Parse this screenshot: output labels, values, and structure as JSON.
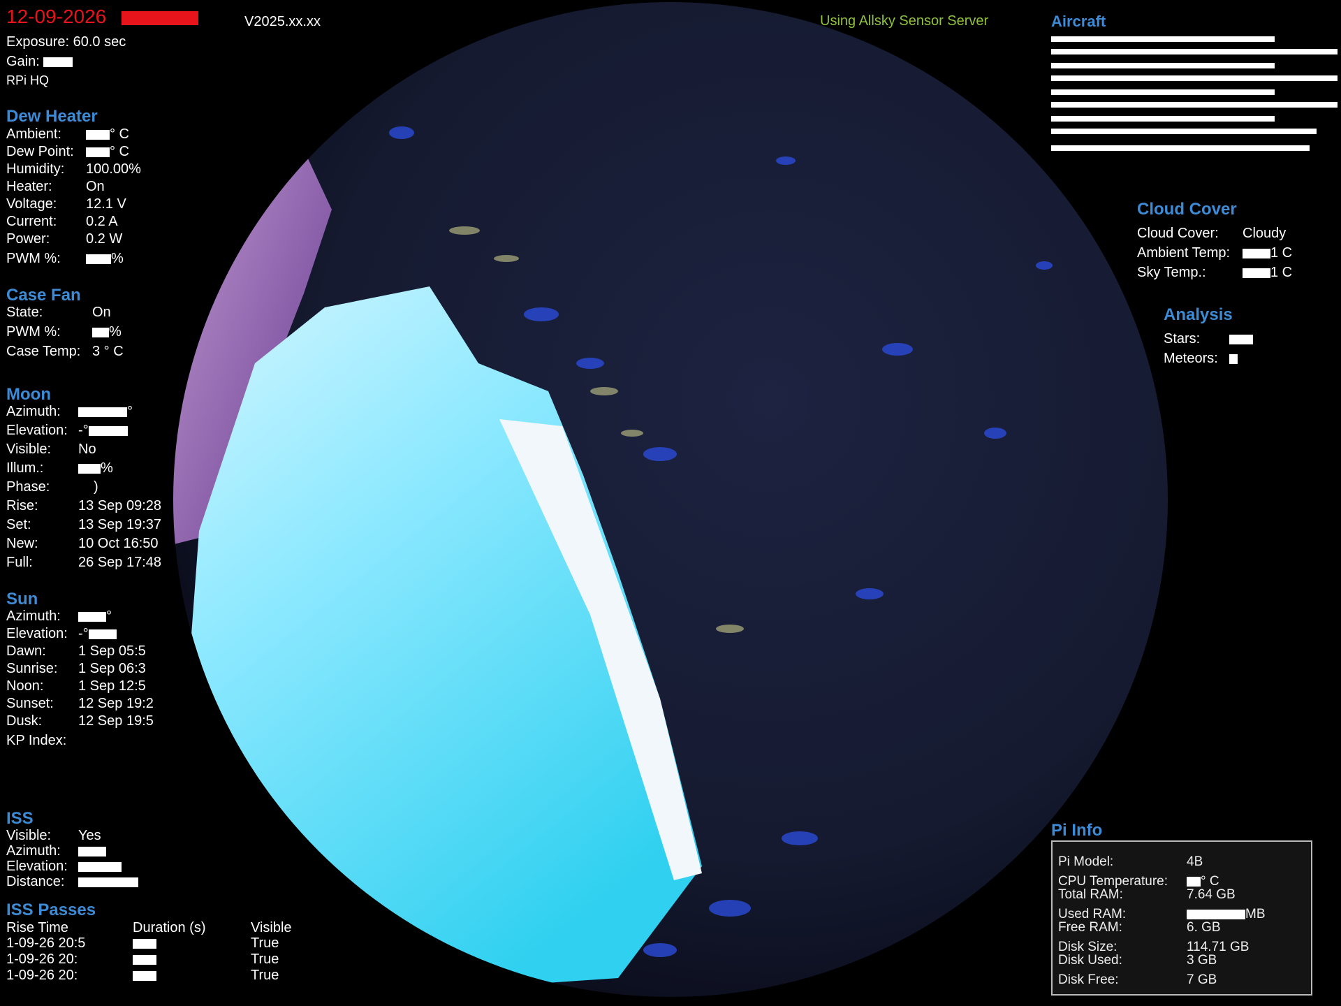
{
  "top": {
    "date": "12-09-2026",
    "version": "V2025.xx.xx",
    "sensor_server": "Using Allsky Sensor Server",
    "exposure": "Exposure: 60.0 sec",
    "gain_label": "Gain:",
    "camera": "RPi  HQ"
  },
  "dew_heater": {
    "title": "Dew Heater",
    "rows": [
      {
        "label": "Ambient:",
        "value": "° C"
      },
      {
        "label": "Dew Point:",
        "value": "° C"
      },
      {
        "label": "Humidity:",
        "value": "100.00%"
      },
      {
        "label": "Heater:",
        "value": "On"
      },
      {
        "label": "Voltage:",
        "value": "12.1 V"
      },
      {
        "label": "Current:",
        "value": "0.2 A"
      },
      {
        "label": "Power:",
        "value": "0.2 W"
      },
      {
        "label": "PWM %:",
        "value": "%"
      }
    ]
  },
  "case_fan": {
    "title": "Case Fan",
    "rows": [
      {
        "label": "State:",
        "value": "On"
      },
      {
        "label": "PWM %:",
        "value": "%"
      },
      {
        "label": "Case Temp:",
        "value": "3 ° C"
      }
    ]
  },
  "moon": {
    "title": "Moon",
    "rows": [
      {
        "label": "Azimuth:",
        "value": "°"
      },
      {
        "label": "Elevation:",
        "value": "-°"
      },
      {
        "label": "Visible:",
        "value": "No"
      },
      {
        "label": "Illum.:",
        "value": "%"
      },
      {
        "label": "Phase:",
        "value": ")"
      },
      {
        "label": "Rise:",
        "value": "13 Sep 09:28"
      },
      {
        "label": "Set:",
        "value": "13 Sep 19:37"
      },
      {
        "label": "New:",
        "value": "10 Oct 16:50"
      },
      {
        "label": "Full:",
        "value": "26 Sep 17:48"
      }
    ]
  },
  "sun": {
    "title": "Sun",
    "rows": [
      {
        "label": "Azimuth:",
        "value": "°"
      },
      {
        "label": "Elevation:",
        "value": "-°"
      },
      {
        "label": "Dawn:",
        "value": "1 Sep 05:5"
      },
      {
        "label": "Sunrise:",
        "value": "1 Sep 06:3"
      },
      {
        "label": "Noon:",
        "value": "1 Sep 12:5"
      },
      {
        "label": "Sunset:",
        "value": "12 Sep 19:2"
      },
      {
        "label": "Dusk:",
        "value": "12 Sep 19:5"
      },
      {
        "label": "KP Index:",
        "value": ""
      }
    ]
  },
  "iss": {
    "title": "ISS",
    "rows": [
      {
        "label": "Visible:",
        "value": "Yes"
      },
      {
        "label": "Azimuth:",
        "value": ""
      },
      {
        "label": "Elevation:",
        "value": ""
      },
      {
        "label": "Distance:",
        "value": ""
      }
    ]
  },
  "iss_passes": {
    "title": "ISS Passes",
    "headers": [
      "Rise Time",
      "Duration (s)",
      "Visible"
    ],
    "rows": [
      [
        "1-09-26 20:5",
        "",
        "True"
      ],
      [
        "1-09-26 20:",
        "",
        "True"
      ],
      [
        "1-09-26 20:",
        "",
        "True"
      ]
    ]
  },
  "aircraft": {
    "title": "Aircraft"
  },
  "cloud_cover": {
    "title": "Cloud Cover",
    "rows": [
      {
        "label": "Cloud Cover:",
        "value": "Cloudy"
      },
      {
        "label": "Ambient Temp:",
        "value": "1 C"
      },
      {
        "label": "Sky Temp.:",
        "value": "1 C"
      }
    ]
  },
  "analysis": {
    "title": "Analysis",
    "rows": [
      {
        "label": "Stars:",
        "value": ""
      },
      {
        "label": "Meteors:",
        "value": ""
      }
    ]
  },
  "pi_info": {
    "title": "Pi Info",
    "rows": [
      {
        "label": "Pi Model:",
        "value": "4B"
      },
      {
        "label": "CPU Temperature:",
        "value": "° C"
      },
      {
        "label": "Total RAM:",
        "value": "7.64 GB"
      },
      {
        "label": "Used RAM:",
        "value": "MB"
      },
      {
        "label": "Free RAM:",
        "value": "6. GB"
      },
      {
        "label": "Disk Size:",
        "value": "114.71 GB"
      },
      {
        "label": "Disk Used:",
        "value": "3 GB"
      },
      {
        "label": "Disk Free:",
        "value": "7 GB"
      }
    ]
  },
  "colors": {
    "header_blue": "#3d8bd6",
    "date_red": "#e8141b",
    "server_green": "#8fc23e"
  }
}
